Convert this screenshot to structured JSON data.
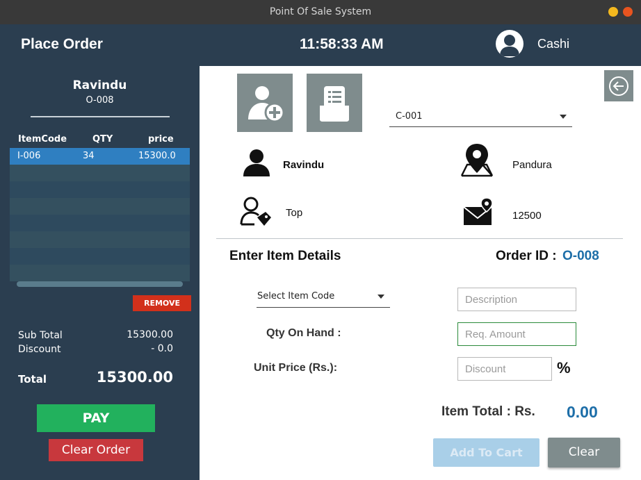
{
  "window": {
    "title": "Point Of Sale System"
  },
  "header": {
    "title": "Place Order",
    "time": "11:58:33 AM",
    "user": "Cashi"
  },
  "order_panel": {
    "customer_name": "Ravindu",
    "order_id": "O-008",
    "columns": {
      "code": "ItemCode",
      "qty": "QTY",
      "price": "price"
    },
    "rows": [
      {
        "code": "I-006",
        "qty": "34",
        "price": "15300.0"
      }
    ],
    "remove_label": "REMOVE",
    "subtotal_label": "Sub Total",
    "subtotal_value": "15300.00",
    "discount_label": "Discount",
    "discount_value": "- 0.0",
    "total_label": "Total",
    "total_value": "15300.00",
    "pay_label": "PAY",
    "clear_order_label": "Clear Order"
  },
  "customer": {
    "selected_id": "C-001",
    "name": "Ravindu",
    "city": "Pandura",
    "type": "Top",
    "postal": "12500"
  },
  "item_form": {
    "section_title": "Enter Item Details",
    "order_id_label": "Order ID :",
    "order_id_value": "O-008",
    "item_code_placeholder": "Select Item Code",
    "description_placeholder": "Description",
    "qty_on_hand_label": "Qty On Hand :",
    "req_amount_placeholder": "Req. Amount",
    "unit_price_label": "Unit Price (Rs.):",
    "discount_placeholder": "Discount",
    "percent_symbol": "%",
    "item_total_label": "Item Total : Rs.",
    "item_total_value": "0.00",
    "add_to_cart_label": "Add To Cart",
    "clear_label": "Clear"
  },
  "colors": {
    "dark_panel": "#2b3e50",
    "accent_blue": "#1d6ea8",
    "pay_green": "#22b15d",
    "danger_red": "#c8383d",
    "gray_button": "#7f8c8d"
  },
  "icons": [
    "add-customer-icon",
    "order-list-icon",
    "back-arrow-icon",
    "person-icon",
    "map-pin-icon",
    "customer-tag-icon",
    "mail-location-icon",
    "user-avatar-icon"
  ]
}
